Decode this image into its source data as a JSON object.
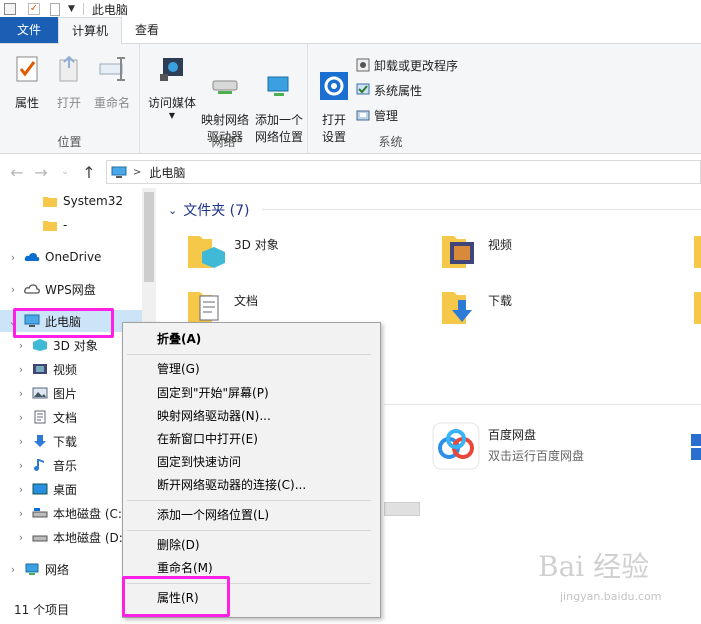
{
  "window": {
    "title": "此电脑"
  },
  "tabs": {
    "file": "文件",
    "computer": "计算机",
    "view": "查看"
  },
  "ribbon": {
    "location": {
      "label": "位置",
      "properties": "属性",
      "open": "打开",
      "rename": "重命名"
    },
    "network": {
      "label": "网络",
      "access_media": "访问媒体",
      "map_drive": "映射网络\n驱动器",
      "add_location": "添加一个\n网络位置"
    },
    "system": {
      "label": "系统",
      "open_settings": "打开\n设置",
      "uninstall": "卸载或更改程序",
      "sys_props": "系统属性",
      "manage": "管理"
    }
  },
  "address": {
    "crumb": "此电脑"
  },
  "nav": {
    "items": [
      {
        "label": "System32"
      },
      {
        "label": "-"
      },
      {
        "label": "OneDrive"
      },
      {
        "label": "WPS网盘"
      },
      {
        "label": "此电脑"
      },
      {
        "label": "3D 对象"
      },
      {
        "label": "视频"
      },
      {
        "label": "图片"
      },
      {
        "label": "文档"
      },
      {
        "label": "下载"
      },
      {
        "label": "音乐"
      },
      {
        "label": "桌面"
      },
      {
        "label": "本地磁盘 (C:"
      },
      {
        "label": "本地磁盘 (D:"
      },
      {
        "label": "网络"
      }
    ]
  },
  "content": {
    "folders_header": "文件夹 (7)",
    "tiles": [
      {
        "name": "3D 对象"
      },
      {
        "name": "视频"
      },
      {
        "name": "文档"
      },
      {
        "name": "下载"
      }
    ],
    "baidu": {
      "name": "百度网盘",
      "sub": "双击运行百度网盘"
    }
  },
  "status": {
    "count": "11 个项目"
  },
  "context_menu": {
    "collapse": "折叠(A)",
    "manage": "管理(G)",
    "pin_start": "固定到\"开始\"屏幕(P)",
    "map_drive": "映射网络驱动器(N)...",
    "open_new_window": "在新窗口中打开(E)",
    "pin_quick": "固定到快速访问",
    "disconnect": "断开网络驱动器的连接(C)...",
    "add_location": "添加一个网络位置(L)",
    "delete": "删除(D)",
    "rename": "重命名(M)",
    "properties": "属性(R)"
  },
  "watermark": {
    "text": "Bai 经验",
    "sub": "jingyan.baidu.com"
  },
  "colors": {
    "accent": "#1a5fb4",
    "highlight": "#ff1fe5",
    "header": "#1e3287"
  }
}
